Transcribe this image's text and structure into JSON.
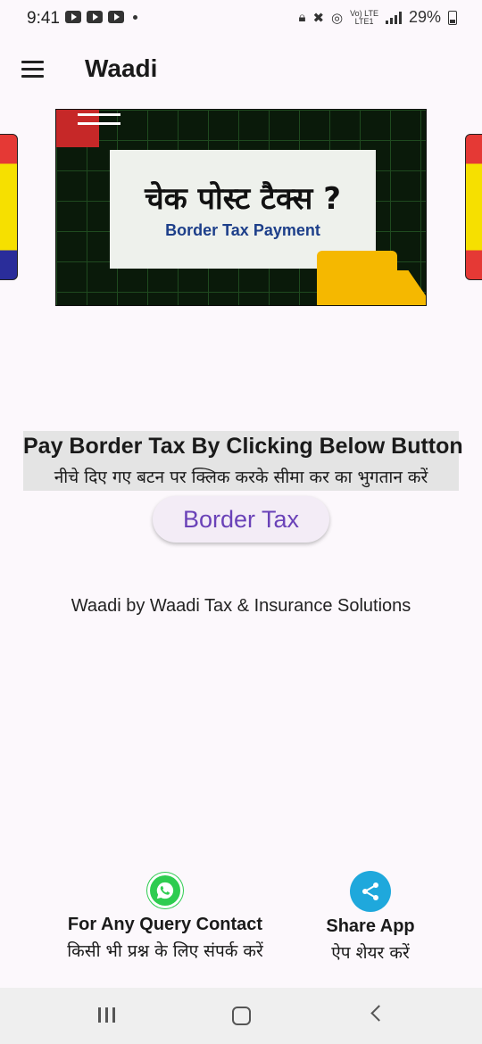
{
  "status_bar": {
    "time": "9:41",
    "lte_label": "Vo) LTE\nLTE1",
    "battery": "29%"
  },
  "app_bar": {
    "title": "Waadi"
  },
  "banner": {
    "hindi_title": "चेक पोस्ट टैक्स ?",
    "english_title": "Border Tax Payment"
  },
  "pay_section": {
    "title": "Pay Border Tax By Clicking Below Button",
    "subtitle": "नीचे दिए गए बटन पर क्लिक करके सीमा कर का भुगतान करें"
  },
  "border_tax_button": {
    "label": "Border Tax"
  },
  "credit": "Waadi by Waadi Tax & Insurance Solutions",
  "contact": {
    "icon": "whatsapp-icon",
    "title": "For Any Query Contact",
    "subtitle": "किसी भी प्रश्न के लिए संपर्क करें"
  },
  "share": {
    "icon": "share-icon",
    "title": "Share App",
    "subtitle": "ऐप शेयर करें"
  },
  "colors": {
    "accent": "#6a42b8",
    "whatsapp": "#2ecc50",
    "share": "#1fa8dc"
  }
}
